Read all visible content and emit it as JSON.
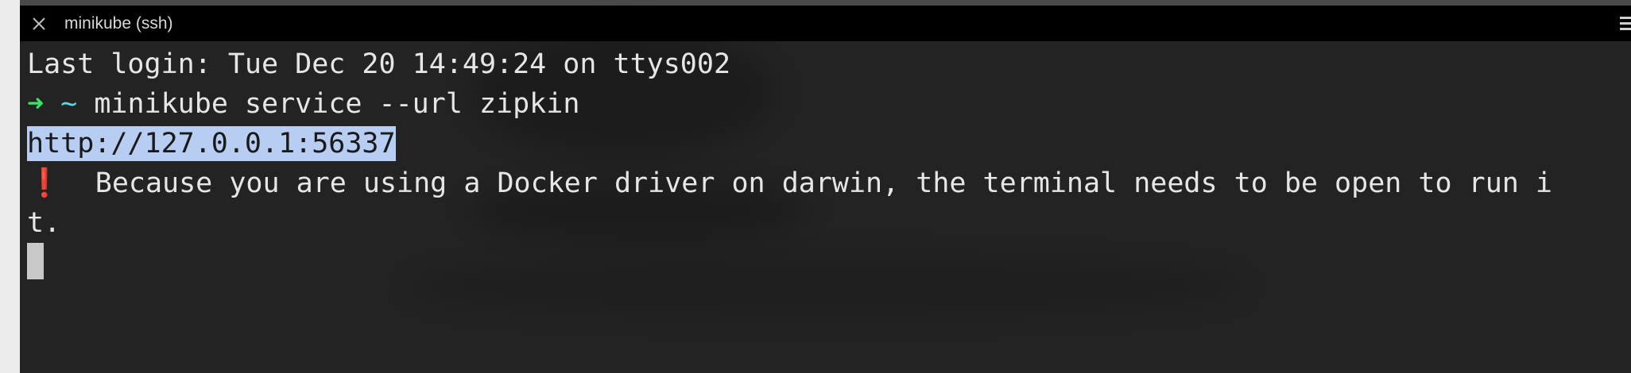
{
  "tab": {
    "title": "minikube (ssh)",
    "close_icon": "close-icon",
    "menu_icon": "hamburger-menu-icon"
  },
  "terminal": {
    "last_login": "Last login: Tue Dec 20 14:49:24 on ttys002",
    "prompt_arrow": "➜",
    "prompt_dir": "~",
    "command": "minikube service --url zipkin",
    "output_url": "http://127.0.0.1:56337",
    "warning_icon": "❗",
    "warning_text_line1": "Because you are using a Docker driver on darwin, the terminal needs to be open to run i",
    "warning_text_line2": "t."
  },
  "colors": {
    "background": "#232323",
    "tab_bar": "#000000",
    "prompt_arrow": "#39e46a",
    "prompt_dir": "#5bd6e6",
    "selection": "#b7cdf2",
    "warning": "#e33a2f"
  }
}
